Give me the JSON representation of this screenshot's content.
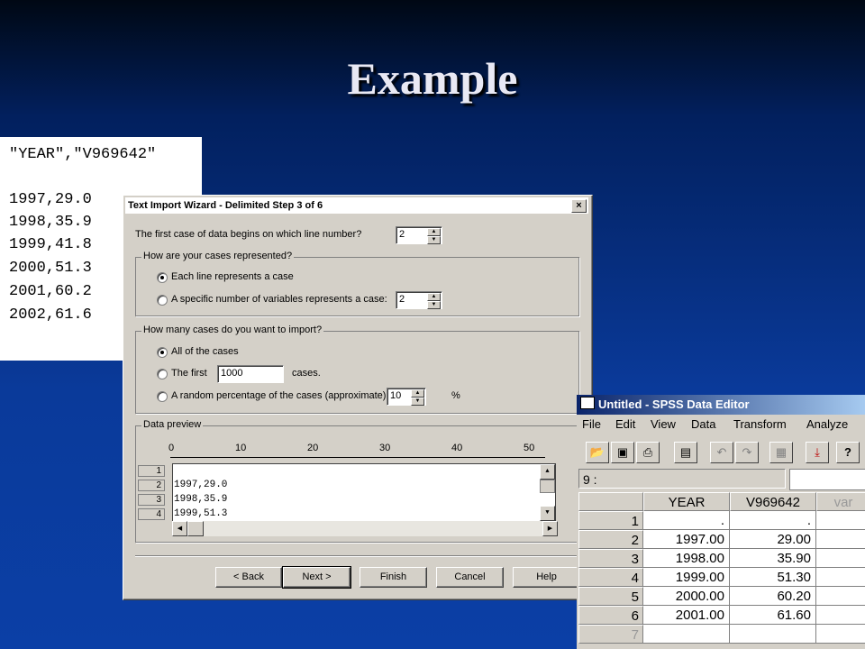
{
  "slide": {
    "title": "Example"
  },
  "text_file": {
    "lines": [
      "\"YEAR\",\"V969642\"",
      "",
      "1997,29.0",
      "1998,35.9",
      "1999,41.8",
      "2000,51.3",
      "2001,60.2",
      "2002,61.6"
    ]
  },
  "wizard": {
    "title": "Text Import Wizard - Delimited Step 3 of 6",
    "close_label": "×",
    "first_line_question": "The first case of data begins on which line number?",
    "first_line_value": "2",
    "cases_group_label": "How are your cases represented?",
    "opt_each_line": "Each line represents a case",
    "opt_specific_vars": "A specific number of variables represents a case:",
    "specific_vars_value": "2",
    "import_group_label": "How many cases do you want to import?",
    "opt_all_cases": "All of the cases",
    "opt_first": "The first",
    "first_n_value": "1000",
    "cases_suffix": "cases.",
    "opt_random": "A random percentage of the cases (approximate):",
    "random_value": "10",
    "percent_sign": "%",
    "preview_group_label": "Data preview",
    "ruler": [
      "0",
      "10",
      "20",
      "30",
      "40",
      "50"
    ],
    "preview_row_numbers": [
      "1",
      "2",
      "3",
      "4"
    ],
    "preview_lines": [
      "",
      "1997,29.0",
      "1998,35.9",
      "1999,51.3"
    ],
    "buttons": {
      "back": "< Back",
      "next": "Next >",
      "finish": "Finish",
      "cancel": "Cancel",
      "help": "Help"
    }
  },
  "spss": {
    "title": "Untitled - SPSS Data Editor",
    "menu": [
      "File",
      "Edit",
      "View",
      "Data",
      "Transform",
      "Analyze"
    ],
    "cell_ref": "9 :",
    "columns": [
      "YEAR",
      "V969642",
      "var"
    ],
    "rows": [
      {
        "n": "1",
        "year": ".",
        "v": "."
      },
      {
        "n": "2",
        "year": "1997.00",
        "v": "29.00"
      },
      {
        "n": "3",
        "year": "1998.00",
        "v": "35.90"
      },
      {
        "n": "4",
        "year": "1999.00",
        "v": "51.30"
      },
      {
        "n": "5",
        "year": "2000.00",
        "v": "60.20"
      },
      {
        "n": "6",
        "year": "2001.00",
        "v": "61.60"
      },
      {
        "n": "7",
        "year": "",
        "v": ""
      }
    ]
  },
  "colors": {
    "title_bar_start": "#0a246a",
    "title_bar_end": "#a6caf0",
    "dialog_face": "#d4d0c8"
  }
}
